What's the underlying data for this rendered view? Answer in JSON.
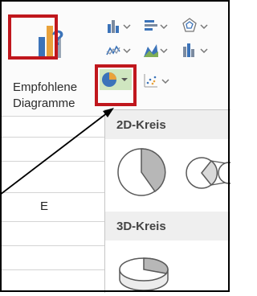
{
  "ribbon": {
    "recommended_charts": {
      "label_line1": "Empfohlene",
      "label_line2": "Diagramme"
    }
  },
  "sheet": {
    "column_header": "E"
  },
  "dropdown": {
    "sections": [
      {
        "title": "2D-Kreis"
      },
      {
        "title": "3D-Kreis"
      }
    ]
  },
  "colors": {
    "highlight": "#c0171d",
    "accent_blue": "#3b73b9",
    "accent_orange": "#e9a23b",
    "icon_green": "#7fae56"
  }
}
